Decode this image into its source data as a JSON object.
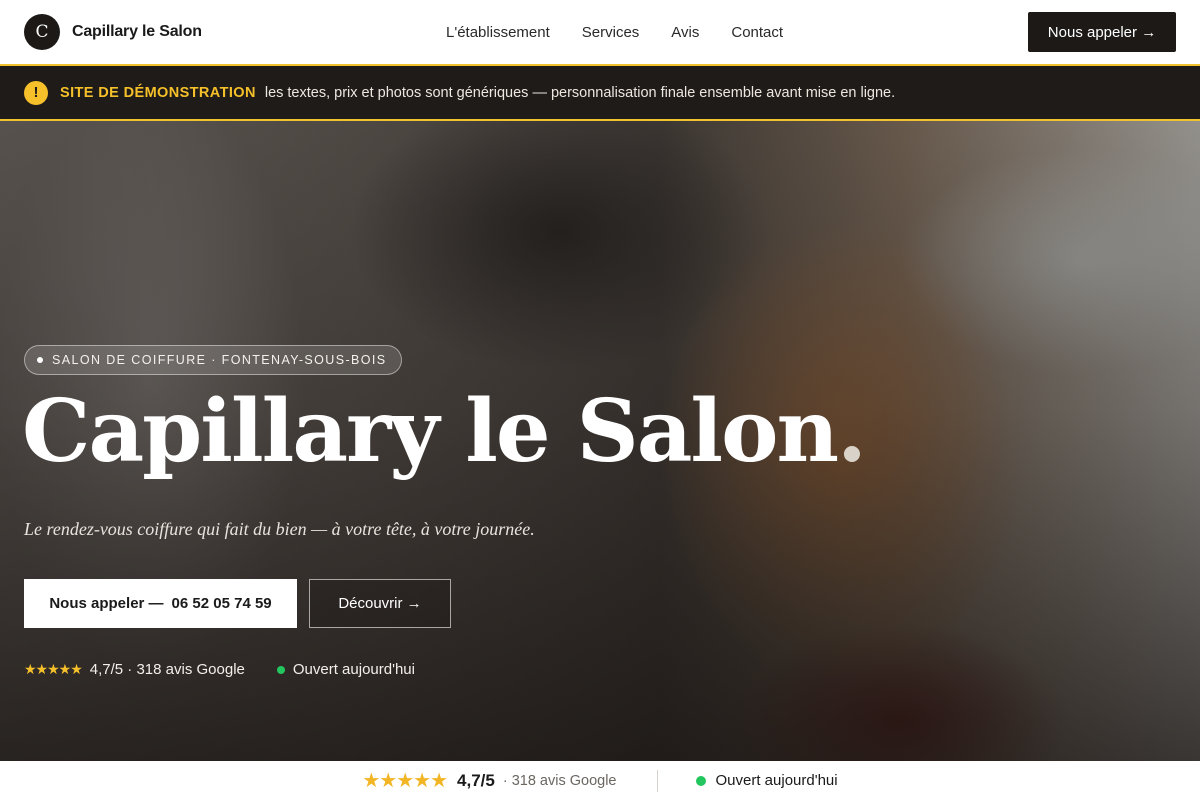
{
  "nav": {
    "logo_letter": "C",
    "brand": "Capillary le Salon",
    "links": [
      "L'établissement",
      "Services",
      "Avis",
      "Contact"
    ],
    "cta": "Nous appeler →"
  },
  "demo_banner": {
    "icon": "!",
    "title": "SITE DE DÉMONSTRATION",
    "text": "les textes, prix et photos sont génériques — personnalisation finale ensemble avant mise en ligne."
  },
  "hero": {
    "badge": "SALON DE COIFFURE · FONTENAY-SOUS-BOIS",
    "title": "Capillary le Salon",
    "title_dot": ".",
    "tagline": "Le rendez-vous coiffure qui fait du bien — à votre tête, à votre journée.",
    "call_label": "Nous appeler —",
    "phone": "06 52 05 74 59",
    "discover": "Découvrir →",
    "stars": "★★★★★",
    "rating": "4,7/5 · 318 avis Google",
    "status": "Ouvert aujourd'hui"
  },
  "strip": {
    "stars": "★★★★★",
    "score": "4,7/5",
    "reviews": "· 318 avis Google",
    "status": "Ouvert aujourd'hui"
  },
  "colors": {
    "accent_yellow": "#f5c02a",
    "dark": "#1c1917",
    "open_green": "#22c55e"
  }
}
